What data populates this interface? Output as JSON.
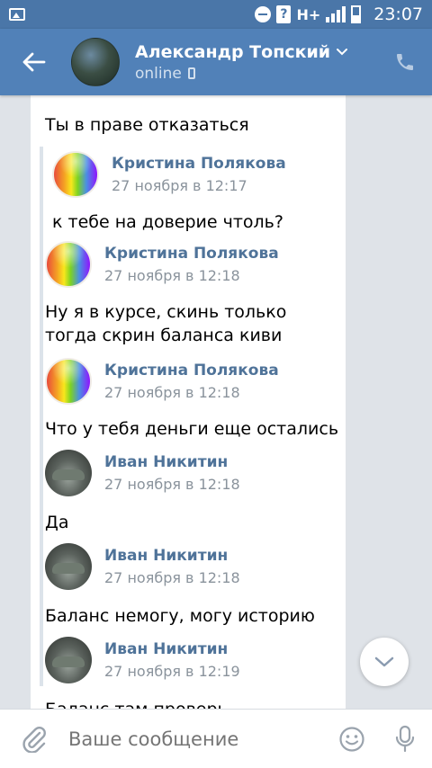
{
  "status_bar": {
    "time": "23:07",
    "network": "H+"
  },
  "header": {
    "back_icon": "arrow-left-icon",
    "name": "Александр Топский",
    "status": "online",
    "call_icon": "phone-icon"
  },
  "messages": [
    {
      "type": "text",
      "text": "Ты в праве отказаться"
    },
    {
      "type": "author",
      "name": "Кристина Полякова",
      "date": "27 ноября в 12:17"
    },
    {
      "type": "text",
      "text": "к тебе на доверие чтоль?"
    },
    {
      "type": "author",
      "name": "Кристина Полякова",
      "date": "27 ноября в 12:18"
    },
    {
      "type": "text",
      "text": "Ну я в курсе, скинь только тогда скрин баланса киви"
    },
    {
      "type": "author",
      "name": "Кристина Полякова",
      "date": "27 ноября в 12:18"
    },
    {
      "type": "text",
      "text": "Что у тебя деньги еще остались"
    },
    {
      "type": "author",
      "name": "Иван Никитин",
      "date": "27 ноября в 12:18"
    },
    {
      "type": "text",
      "text": "Да"
    },
    {
      "type": "author",
      "name": "Иван Никитин",
      "date": "27 ноября в 12:18"
    },
    {
      "type": "text",
      "text": "Баланс немогу, могу историю"
    },
    {
      "type": "author",
      "name": "Иван Никитин",
      "date": "27 ноября в 12:19"
    },
    {
      "type": "text",
      "text": "Баланс там проверь"
    }
  ],
  "input": {
    "placeholder": "Ваше сообщение"
  },
  "colors": {
    "header_bg": "#5181b8",
    "status_bg": "#4a76a8",
    "author_name": "#4f7399",
    "date": "#8a939c"
  }
}
